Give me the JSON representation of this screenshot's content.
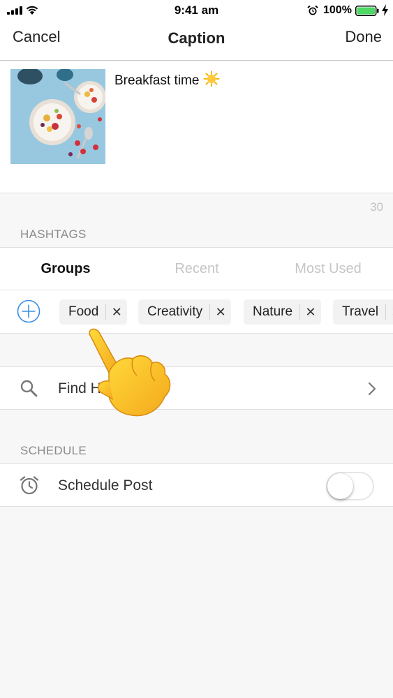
{
  "status_bar": {
    "time": "9:41 am",
    "battery_percent": "100%",
    "battery_color": "#4cd964"
  },
  "nav": {
    "cancel_label": "Cancel",
    "title": "Caption",
    "done_label": "Done"
  },
  "caption": {
    "text": "Breakfast time",
    "emoji_icon": "sun-emoji",
    "characters_remaining": "30"
  },
  "hashtags": {
    "section_title": "HASHTAGS",
    "tabs": [
      {
        "label": "Groups",
        "active": true
      },
      {
        "label": "Recent",
        "active": false
      },
      {
        "label": "Most Used",
        "active": false
      }
    ],
    "add_icon": "plus-circle-icon",
    "accent_color": "#3a8ee6",
    "groups": [
      {
        "label": "Food"
      },
      {
        "label": "Creativity"
      },
      {
        "label": "Nature"
      },
      {
        "label": "Travel"
      }
    ],
    "find_label": "Find Hashtags"
  },
  "schedule": {
    "section_title": "SCHEDULE",
    "label": "Schedule Post",
    "enabled": false
  },
  "overlay": {
    "icon": "pointing-hand-emoji"
  }
}
